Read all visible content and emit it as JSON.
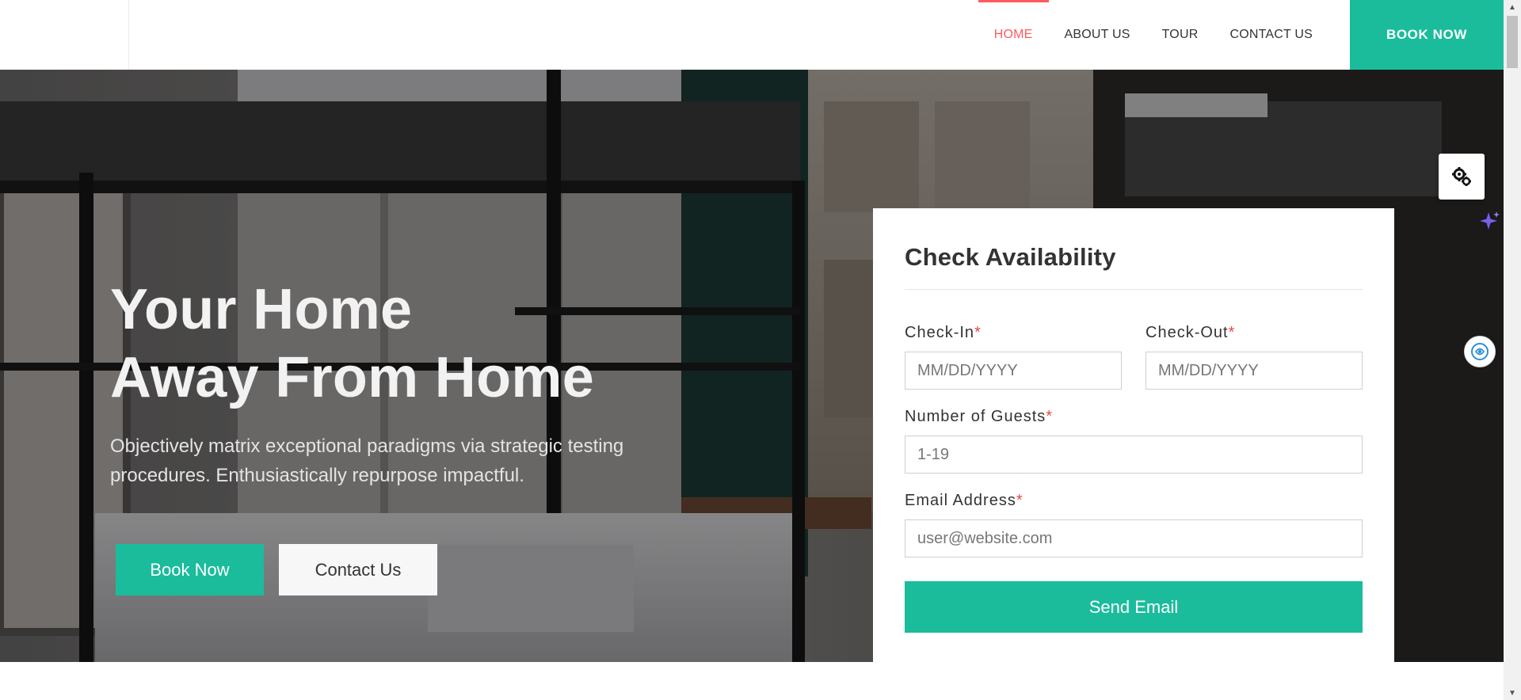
{
  "header": {
    "nav": [
      {
        "label": "HOME",
        "active": true
      },
      {
        "label": "ABOUT US",
        "active": false
      },
      {
        "label": "TOUR",
        "active": false
      },
      {
        "label": "CONTACT US",
        "active": false
      }
    ],
    "cta_label": "BOOK NOW"
  },
  "hero": {
    "title_line1": "Your Home",
    "title_line2": "Away From Home",
    "subtitle": "Objectively matrix exceptional paradigms via strategic testing procedures. Enthusiastically repurpose impactful.",
    "book_label": "Book Now",
    "contact_label": "Contact Us"
  },
  "availability": {
    "title": "Check Availability",
    "checkin_label": "Check-In",
    "checkin_placeholder": "MM/DD/YYYY",
    "checkout_label": "Check-Out",
    "checkout_placeholder": "MM/DD/YYYY",
    "guests_label": "Number of Guests",
    "guests_placeholder": "1-19",
    "email_label": "Email Address",
    "email_placeholder": "user@website.com",
    "required_mark": "*",
    "submit_label": "Send Email"
  },
  "colors": {
    "accent": "#1abc9c",
    "active_nav": "#ff5a5f",
    "required": "#e74c3c"
  },
  "icons": {
    "settings": "gears-icon",
    "sparkle": "sparkle-icon",
    "assistant": "ai-assistant-icon"
  }
}
